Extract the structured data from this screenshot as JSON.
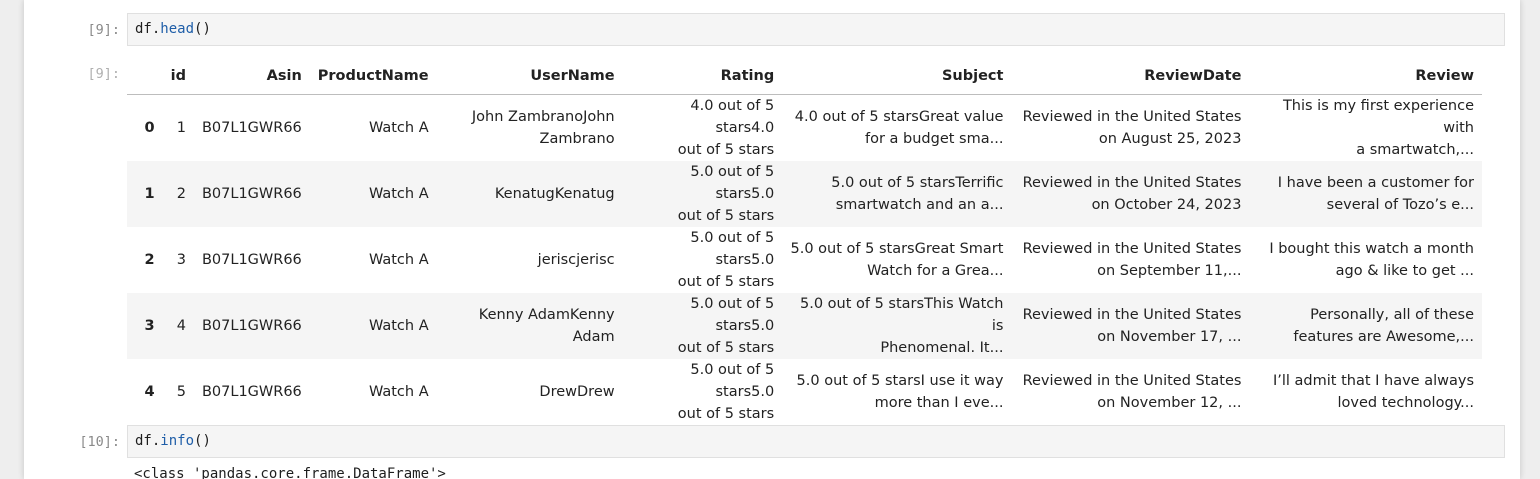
{
  "cell9": {
    "in_prompt": "[9]:",
    "code_obj": "df.",
    "code_fn": "head",
    "code_tail": "()",
    "out_prompt": "[9]:"
  },
  "cell10": {
    "in_prompt": "[10]:",
    "code_obj": "df.",
    "code_fn": "info",
    "code_tail": "()",
    "output_partial": "<class 'pandas.core.frame.DataFrame'>"
  },
  "table": {
    "headers": [
      "",
      "id",
      "Asin",
      "ProductName",
      "UserName",
      "Rating",
      "Subject",
      "ReviewDate",
      "Review"
    ],
    "rows": [
      {
        "index": "0",
        "id": "1",
        "asin": "B07L1GWR66",
        "product": "Watch A",
        "user": [
          "John ZambranoJohn",
          "Zambrano"
        ],
        "rating": [
          "4.0 out of 5 stars4.0",
          "out of 5 stars"
        ],
        "subject": [
          "4.0 out of 5 starsGreat value",
          "for a budget sma..."
        ],
        "date": [
          "Reviewed in the United States",
          "on August 25, 2023"
        ],
        "review": [
          "This is my first experience with",
          "a smartwatch,..."
        ]
      },
      {
        "index": "1",
        "id": "2",
        "asin": "B07L1GWR66",
        "product": "Watch A",
        "user": [
          "KenatugKenatug"
        ],
        "rating": [
          "5.0 out of 5 stars5.0",
          "out of 5 stars"
        ],
        "subject": [
          "5.0 out of 5 starsTerrific",
          "smartwatch and an a..."
        ],
        "date": [
          "Reviewed in the United States",
          "on October 24, 2023"
        ],
        "review": [
          "I have been a customer for",
          "several of Tozo’s e..."
        ]
      },
      {
        "index": "2",
        "id": "3",
        "asin": "B07L1GWR66",
        "product": "Watch A",
        "user": [
          "jeriscjerisc"
        ],
        "rating": [
          "5.0 out of 5 stars5.0",
          "out of 5 stars"
        ],
        "subject": [
          "5.0 out of 5 starsGreat Smart",
          "Watch for a Grea..."
        ],
        "date": [
          "Reviewed in the United States",
          "on September 11,..."
        ],
        "review": [
          "I bought this watch a month",
          "ago & like to get ..."
        ]
      },
      {
        "index": "3",
        "id": "4",
        "asin": "B07L1GWR66",
        "product": "Watch A",
        "user": [
          "Kenny AdamKenny",
          "Adam"
        ],
        "rating": [
          "5.0 out of 5 stars5.0",
          "out of 5 stars"
        ],
        "subject": [
          "5.0 out of 5 starsThis Watch is",
          "Phenomenal. It..."
        ],
        "date": [
          "Reviewed in the United States",
          "on November 17, ..."
        ],
        "review": [
          "Personally, all of these",
          "features are Awesome,..."
        ]
      },
      {
        "index": "4",
        "id": "5",
        "asin": "B07L1GWR66",
        "product": "Watch A",
        "user": [
          "DrewDrew"
        ],
        "rating": [
          "5.0 out of 5 stars5.0",
          "out of 5 stars"
        ],
        "subject": [
          "5.0 out of 5 starsI use it way",
          "more than I eve..."
        ],
        "date": [
          "Reviewed in the United States",
          "on November 12, ..."
        ],
        "review": [
          "I’ll admit that I have always",
          "loved technology..."
        ]
      }
    ]
  }
}
